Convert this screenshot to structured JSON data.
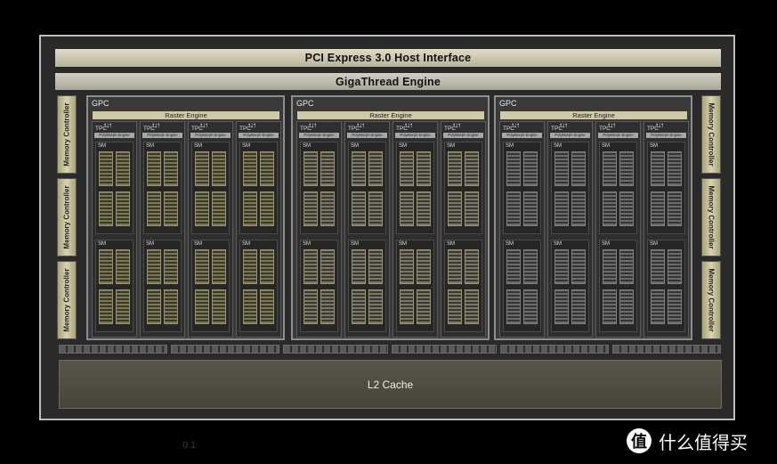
{
  "diagram": {
    "pcie_label": "PCI Express 3.0 Host Interface",
    "gigathread_label": "GigaThread Engine",
    "memory_controller_label": "Memory Controller",
    "gpc_label": "GPC",
    "raster_label": "Raster Engine",
    "tpc_label": "TPC",
    "polymorph_label": "PolyMorph Engine",
    "sm_label": "SM",
    "l2_label": "L2 Cache",
    "arrow_symbol": "↑↓↑",
    "gpc_count": 3,
    "tpc_per_gpc": 4,
    "sm_per_tpc": 2
  },
  "watermark": {
    "logo_text": "值",
    "text": "什么值得买"
  },
  "stray_text": "0.1"
}
